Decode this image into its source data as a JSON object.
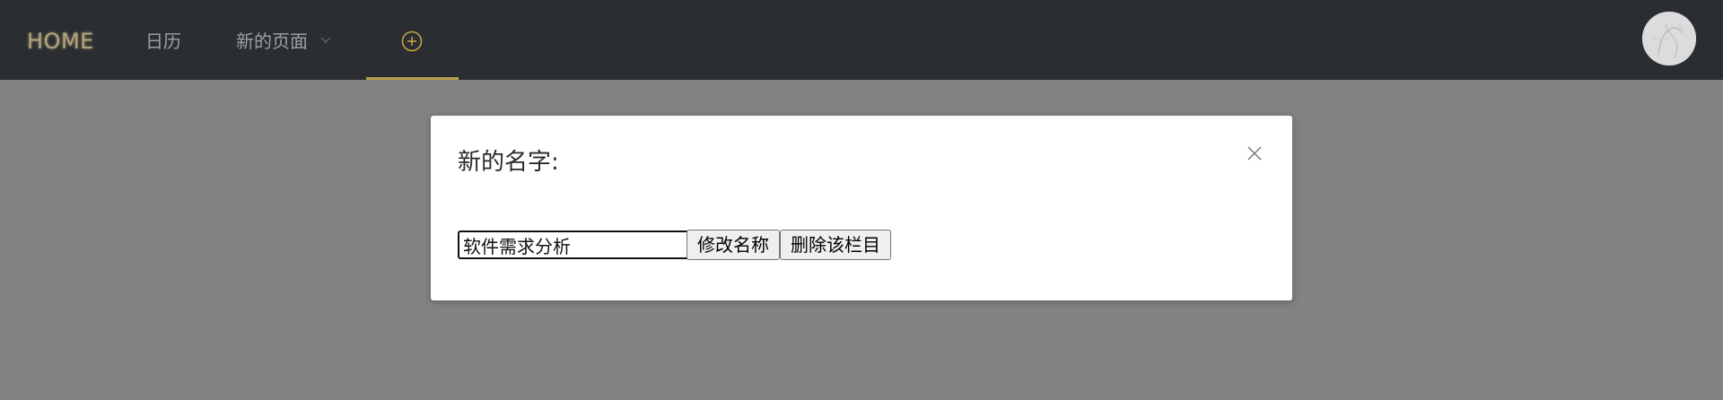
{
  "navbar": {
    "home_label": "HOME",
    "items": [
      {
        "label": "日历"
      },
      {
        "label": "新的页面",
        "icon": "chevron-down-icon"
      }
    ],
    "add_icon": "plus-circle-icon",
    "accent_color": "#b8a04a",
    "background_color": "#2a2d32"
  },
  "avatar": {
    "icon": "avatar-icon"
  },
  "modal": {
    "title": "新的名字:",
    "close_icon": "close-icon",
    "input_value": "软件需求分析",
    "rename_button": "修改名称",
    "delete_button": "删除该栏目"
  }
}
